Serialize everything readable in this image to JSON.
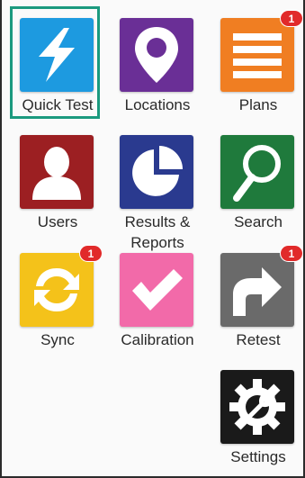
{
  "tiles": [
    {
      "name": "quick-test",
      "label": "Quick Test",
      "icon": "lightning-icon",
      "color": "#1d9ae0",
      "badge": ""
    },
    {
      "name": "locations",
      "label": "Locations",
      "icon": "map-pin-icon",
      "color": "#6a2f96",
      "badge": ""
    },
    {
      "name": "plans",
      "label": "Plans",
      "icon": "list-icon",
      "color": "#f07e22",
      "badge": "1"
    },
    {
      "name": "users",
      "label": "Users",
      "icon": "user-icon",
      "color": "#9c1f22",
      "badge": ""
    },
    {
      "name": "results-reports",
      "label": "Results &\nReports",
      "icon": "pie-chart-icon",
      "color": "#2a3a8f",
      "badge": ""
    },
    {
      "name": "search",
      "label": "Search",
      "icon": "magnifier-icon",
      "color": "#1f7a3c",
      "badge": ""
    },
    {
      "name": "sync",
      "label": "Sync",
      "icon": "sync-icon",
      "color": "#f4c21a",
      "badge": "1"
    },
    {
      "name": "calibration",
      "label": "Calibration",
      "icon": "check-icon",
      "color": "#f26aa9",
      "badge": ""
    },
    {
      "name": "retest",
      "label": "Retest",
      "icon": "redo-arrow-icon",
      "color": "#6a6a6a",
      "badge": "1"
    },
    {
      "name": "settings",
      "label": "Settings",
      "icon": "gear-wrench-icon",
      "color": "#1a1a1a",
      "badge": ""
    }
  ],
  "selected": "Quick Test"
}
